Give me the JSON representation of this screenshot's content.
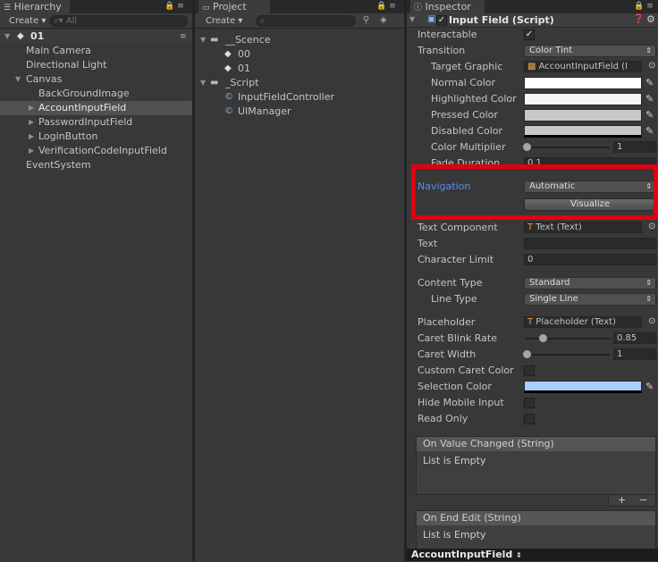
{
  "hierarchy": {
    "tab_label": "Hierarchy",
    "create_label": "Create",
    "search_placeholder": "All",
    "scene_name": "01",
    "items": [
      {
        "label": "Main Camera"
      },
      {
        "label": "Directional Light"
      },
      {
        "label": "Canvas"
      },
      {
        "label": "BackGroundImage"
      },
      {
        "label": "AccountInputField"
      },
      {
        "label": "PasswordInputField"
      },
      {
        "label": "LoginButton"
      },
      {
        "label": "VerificationCodeInputField"
      },
      {
        "label": "EventSystem"
      }
    ]
  },
  "project": {
    "tab_label": "Project",
    "create_label": "Create",
    "items": [
      {
        "label": "__Scence"
      },
      {
        "label": "00"
      },
      {
        "label": "01"
      },
      {
        "label": "_Script"
      },
      {
        "label": "InputFieldController"
      },
      {
        "label": "UIManager"
      }
    ]
  },
  "inspector": {
    "tab_label": "Inspector",
    "component_title": "Input Field (Script)",
    "interactable_label": "Interactable",
    "transition_label": "Transition",
    "transition_value": "Color Tint",
    "target_graphic_label": "Target Graphic",
    "target_graphic_value": "AccountInputField (I",
    "normal_color_label": "Normal Color",
    "highlighted_color_label": "Highlighted Color",
    "pressed_color_label": "Pressed Color",
    "disabled_color_label": "Disabled Color",
    "color_multiplier_label": "Color Multiplier",
    "color_multiplier_value": "1",
    "fade_duration_label": "Fade Duration",
    "fade_duration_value": "0.1",
    "navigation_label": "Navigation",
    "navigation_value": "Automatic",
    "visualize_label": "Visualize",
    "text_component_label": "Text Component",
    "text_component_value": "Text (Text)",
    "text_label": "Text",
    "text_value": "",
    "char_limit_label": "Character Limit",
    "char_limit_value": "0",
    "content_type_label": "Content Type",
    "content_type_value": "Standard",
    "line_type_label": "Line Type",
    "line_type_value": "Single Line",
    "placeholder_label": "Placeholder",
    "placeholder_value": "Placeholder (Text)",
    "caret_blink_label": "Caret Blink Rate",
    "caret_blink_value": "0.85",
    "caret_width_label": "Caret Width",
    "caret_width_value": "1",
    "custom_caret_label": "Custom Caret Color",
    "selection_color_label": "Selection Color",
    "hide_mobile_label": "Hide Mobile Input",
    "read_only_label": "Read Only",
    "on_value_changed": "On Value Changed (String)",
    "list_empty_1": "List is Empty",
    "on_end_edit": "On End Edit (String)",
    "list_empty_2": "List is Empty",
    "plus": "+",
    "minus": "−",
    "footer_object": "AccountInputField"
  },
  "colors": {
    "highlight_box": "#e0000f",
    "selection_color": "#a8cdff",
    "navigation_text": "#5a8ee8"
  }
}
